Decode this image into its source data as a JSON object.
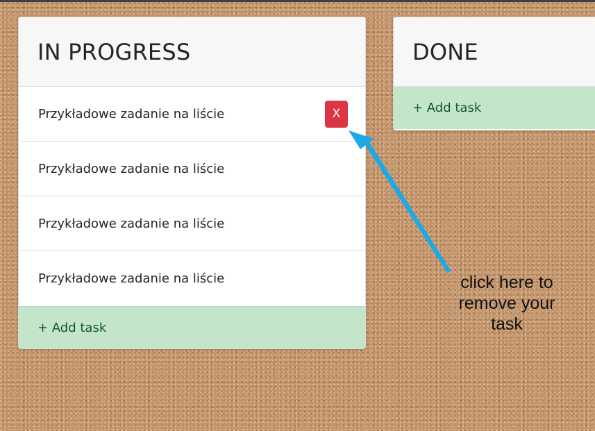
{
  "columns": [
    {
      "title": "IN PROGRESS",
      "tasks": [
        "Przykładowe zadanie na liście",
        "Przykładowe zadanie na liście",
        "Przykładowe zadanie na liście",
        "Przykładowe zadanie na liście"
      ],
      "delete_label": "X",
      "add_label": "+ Add task"
    },
    {
      "title": "DONE",
      "tasks": [],
      "add_label": "+ Add task"
    }
  ],
  "annotation": {
    "line1": "click here to",
    "line2": "remove your",
    "line3": "task"
  },
  "colors": {
    "delete_button": "#dc3545",
    "add_row": "#c3e6cb",
    "arrow": "#1ca9e6",
    "board": "#c2946b"
  },
  "icons": {
    "arrow": "pointer-arrow"
  }
}
